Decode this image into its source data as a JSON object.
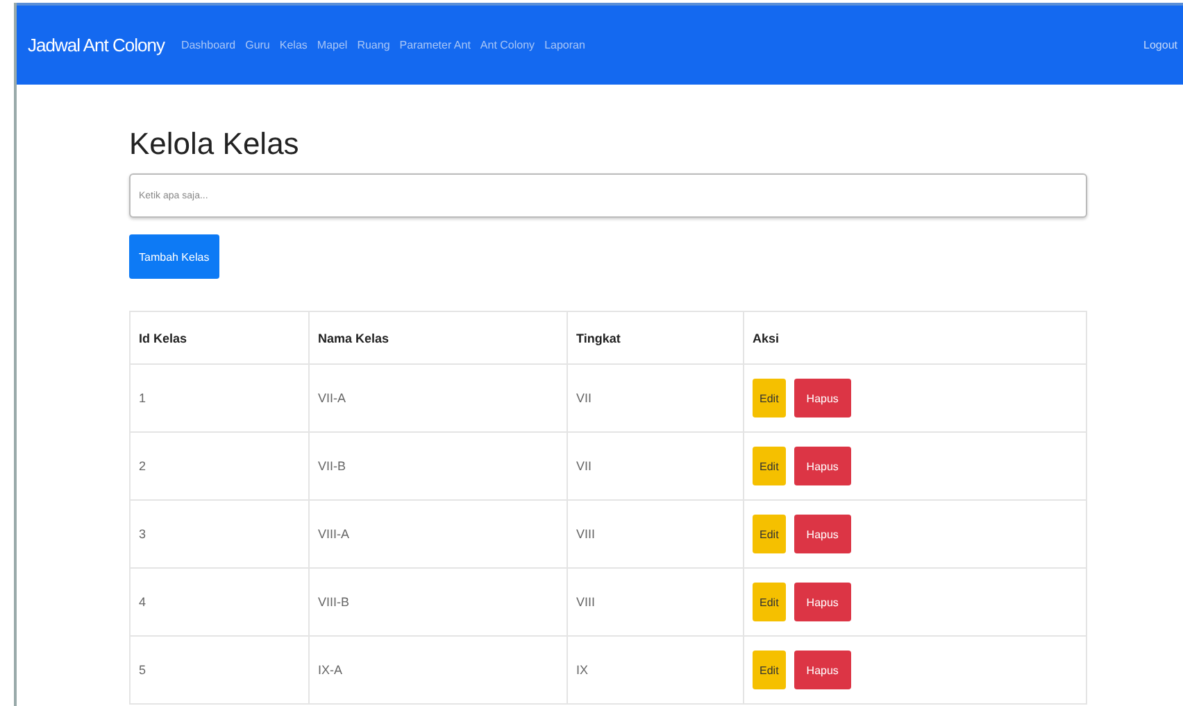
{
  "navbar": {
    "brand": "Jadwal Ant Colony",
    "links": [
      {
        "label": "Dashboard"
      },
      {
        "label": "Guru"
      },
      {
        "label": "Kelas"
      },
      {
        "label": "Mapel"
      },
      {
        "label": "Ruang"
      },
      {
        "label": "Parameter Ant"
      },
      {
        "label": "Ant Colony"
      },
      {
        "label": "Laporan"
      }
    ],
    "logout": "Logout"
  },
  "title": "Kelola Kelas",
  "search": {
    "placeholder": "Ketik apa saja..."
  },
  "add_button": "Tambah Kelas",
  "table": {
    "columns": [
      "Id Kelas",
      "Nama Kelas",
      "Tingkat",
      "Aksi"
    ],
    "rows": [
      {
        "id": "1",
        "name": "VII-A",
        "level": "VII",
        "edit": "Edit",
        "delete": "Hapus"
      },
      {
        "id": "2",
        "name": "VII-B",
        "level": "VII",
        "edit": "Edit",
        "delete": "Hapus"
      },
      {
        "id": "3",
        "name": "VIII-A",
        "level": "VIII",
        "edit": "Edit",
        "delete": "Hapus"
      },
      {
        "id": "4",
        "name": "VIII-B",
        "level": "VIII",
        "edit": "Edit",
        "delete": "Hapus"
      },
      {
        "id": "5",
        "name": "IX-A",
        "level": "IX",
        "edit": "Edit",
        "delete": "Hapus"
      }
    ]
  }
}
